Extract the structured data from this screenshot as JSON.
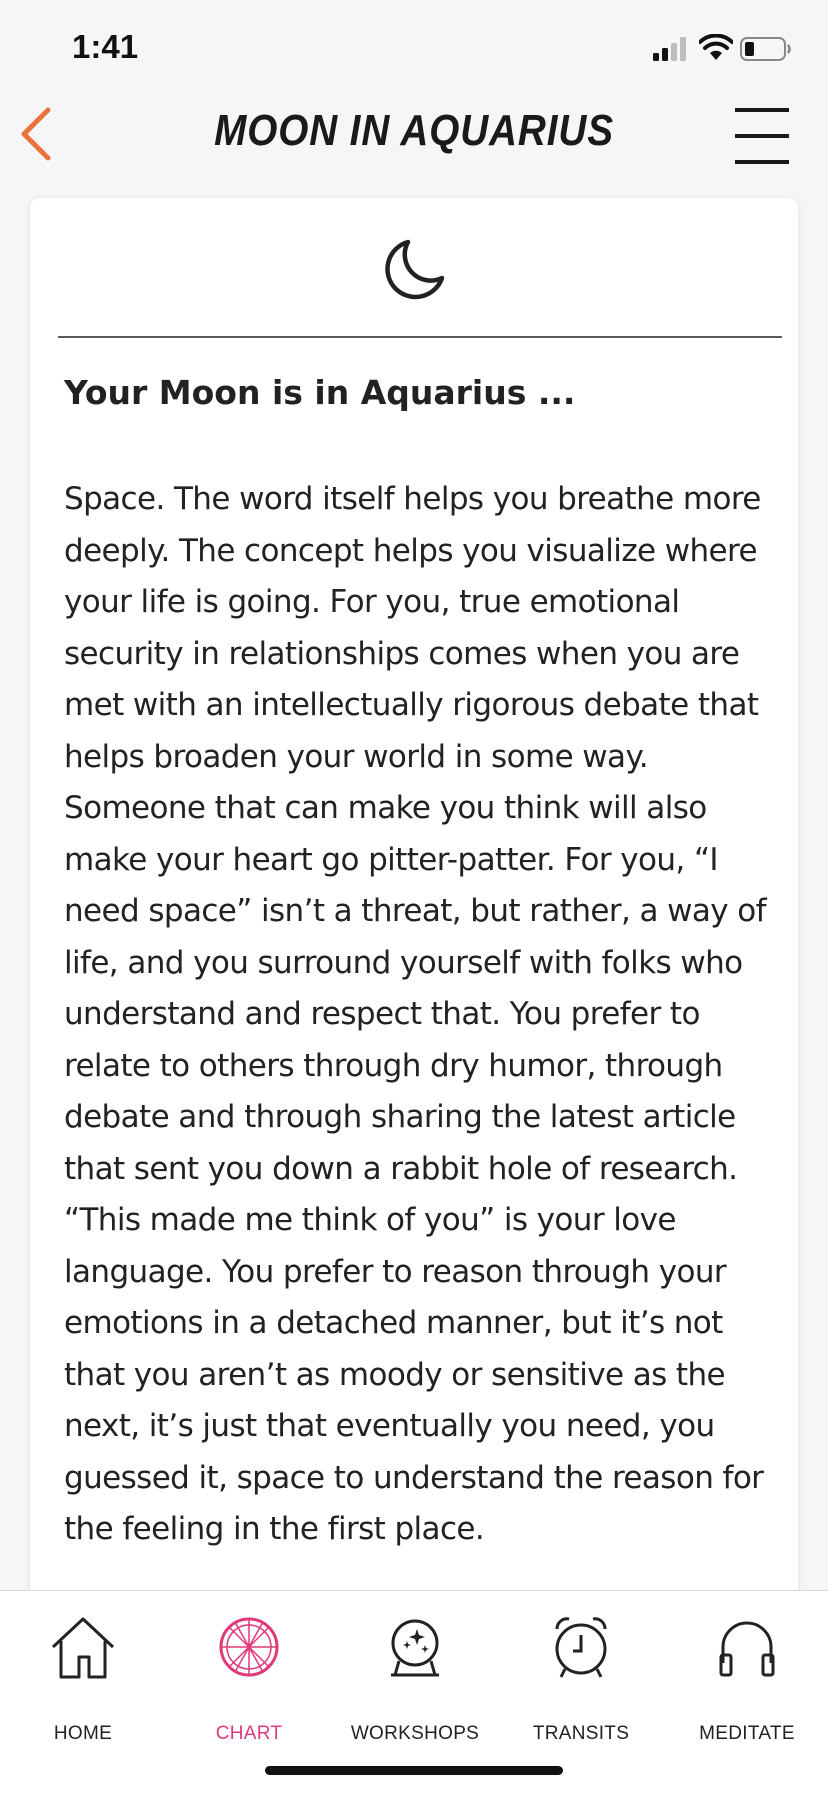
{
  "status_bar": {
    "time": "1:41"
  },
  "header": {
    "title": "MOON IN AQUARIUS"
  },
  "card": {
    "icon": "moon-icon",
    "subtitle": "Your Moon is in Aquarius ...",
    "body": "Space. The word itself helps you breathe more deeply. The concept helps you visualize where your life is going. For you, true emotional security in relationships comes when you are met with an intellectually rigorous debate that helps broaden your world in some way. Someone that can make you think will also make your heart go pitter-patter. For you, “I need space” isn’t a threat, but rather, a way of life, and you surround yourself with folks who understand and respect that. You prefer to relate to others through dry humor, through debate and through sharing the latest article that sent you down a rabbit hole of research. “This made me think of you” is your love language. You prefer to reason through your emotions in a detached manner, but it’s not that you aren’t as moody or sensitive as the next, it’s just that eventually you need, you guessed it, space to understand the reason for the feeling in the first place."
  },
  "tabs": [
    {
      "label": "HOME",
      "icon": "house-icon",
      "active": false
    },
    {
      "label": "CHART",
      "icon": "chart-wheel-icon",
      "active": true
    },
    {
      "label": "WORKSHOPS",
      "icon": "crystal-ball-icon",
      "active": false
    },
    {
      "label": "TRANSITS",
      "icon": "alarm-clock-icon",
      "active": false
    },
    {
      "label": "MEDITATE",
      "icon": "headphones-icon",
      "active": false
    }
  ],
  "colors": {
    "accent": "#e0397a",
    "back_arrow": "#e8743b",
    "background": "#f6f6f6"
  }
}
